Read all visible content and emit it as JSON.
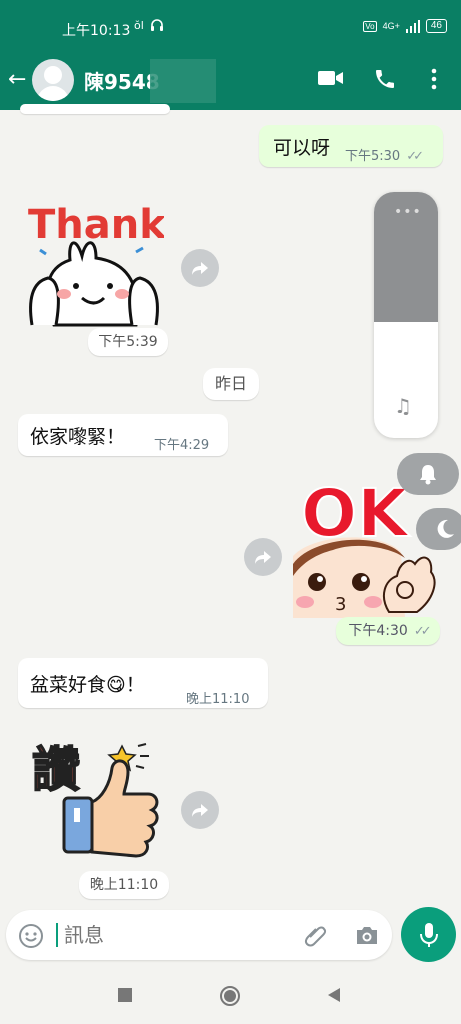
{
  "status_bar": {
    "time": "上午10:13",
    "left_icons": "ꝺ",
    "network": "4G+",
    "battery": "46"
  },
  "header": {
    "back_icon": "arrow-left-icon",
    "contact_name": "陳9548",
    "actions": [
      "video-call-icon",
      "voice-call-icon",
      "more-vert-icon"
    ]
  },
  "messages": [
    {
      "dir": "out",
      "text": "可以呀",
      "time": "下午5:30",
      "ticks": "✓✓"
    },
    {
      "dir": "in",
      "sticker": "Thanks",
      "time": "下午5:39"
    },
    {
      "date_divider": "昨日"
    },
    {
      "dir": "in",
      "text": "依家嚟緊！",
      "time": "下午4:29"
    },
    {
      "dir": "out",
      "sticker": "OK",
      "time": "下午4:30",
      "ticks": "✓✓"
    },
    {
      "dir": "in",
      "text": "盆菜好食😋！",
      "time": "晚上11:10"
    },
    {
      "dir": "in",
      "sticker": "讚",
      "time": "晚上11:10"
    }
  ],
  "input": {
    "placeholder": "訊息",
    "emoji_icon": "emoji-icon",
    "attach_icon": "paperclip-icon",
    "camera_icon": "camera-icon",
    "mic_icon": "mic-icon"
  },
  "volume_panel": {
    "level": 0.47,
    "dots": "•••",
    "music_icon": "music-note-icon",
    "ring_icon": "bell-icon",
    "dnd_icon": "moon-icon"
  },
  "colors": {
    "header": "#0a7f64",
    "accent": "#0a9e7c",
    "outgoing": "#e7ffdb",
    "incoming": "#ffffff"
  }
}
